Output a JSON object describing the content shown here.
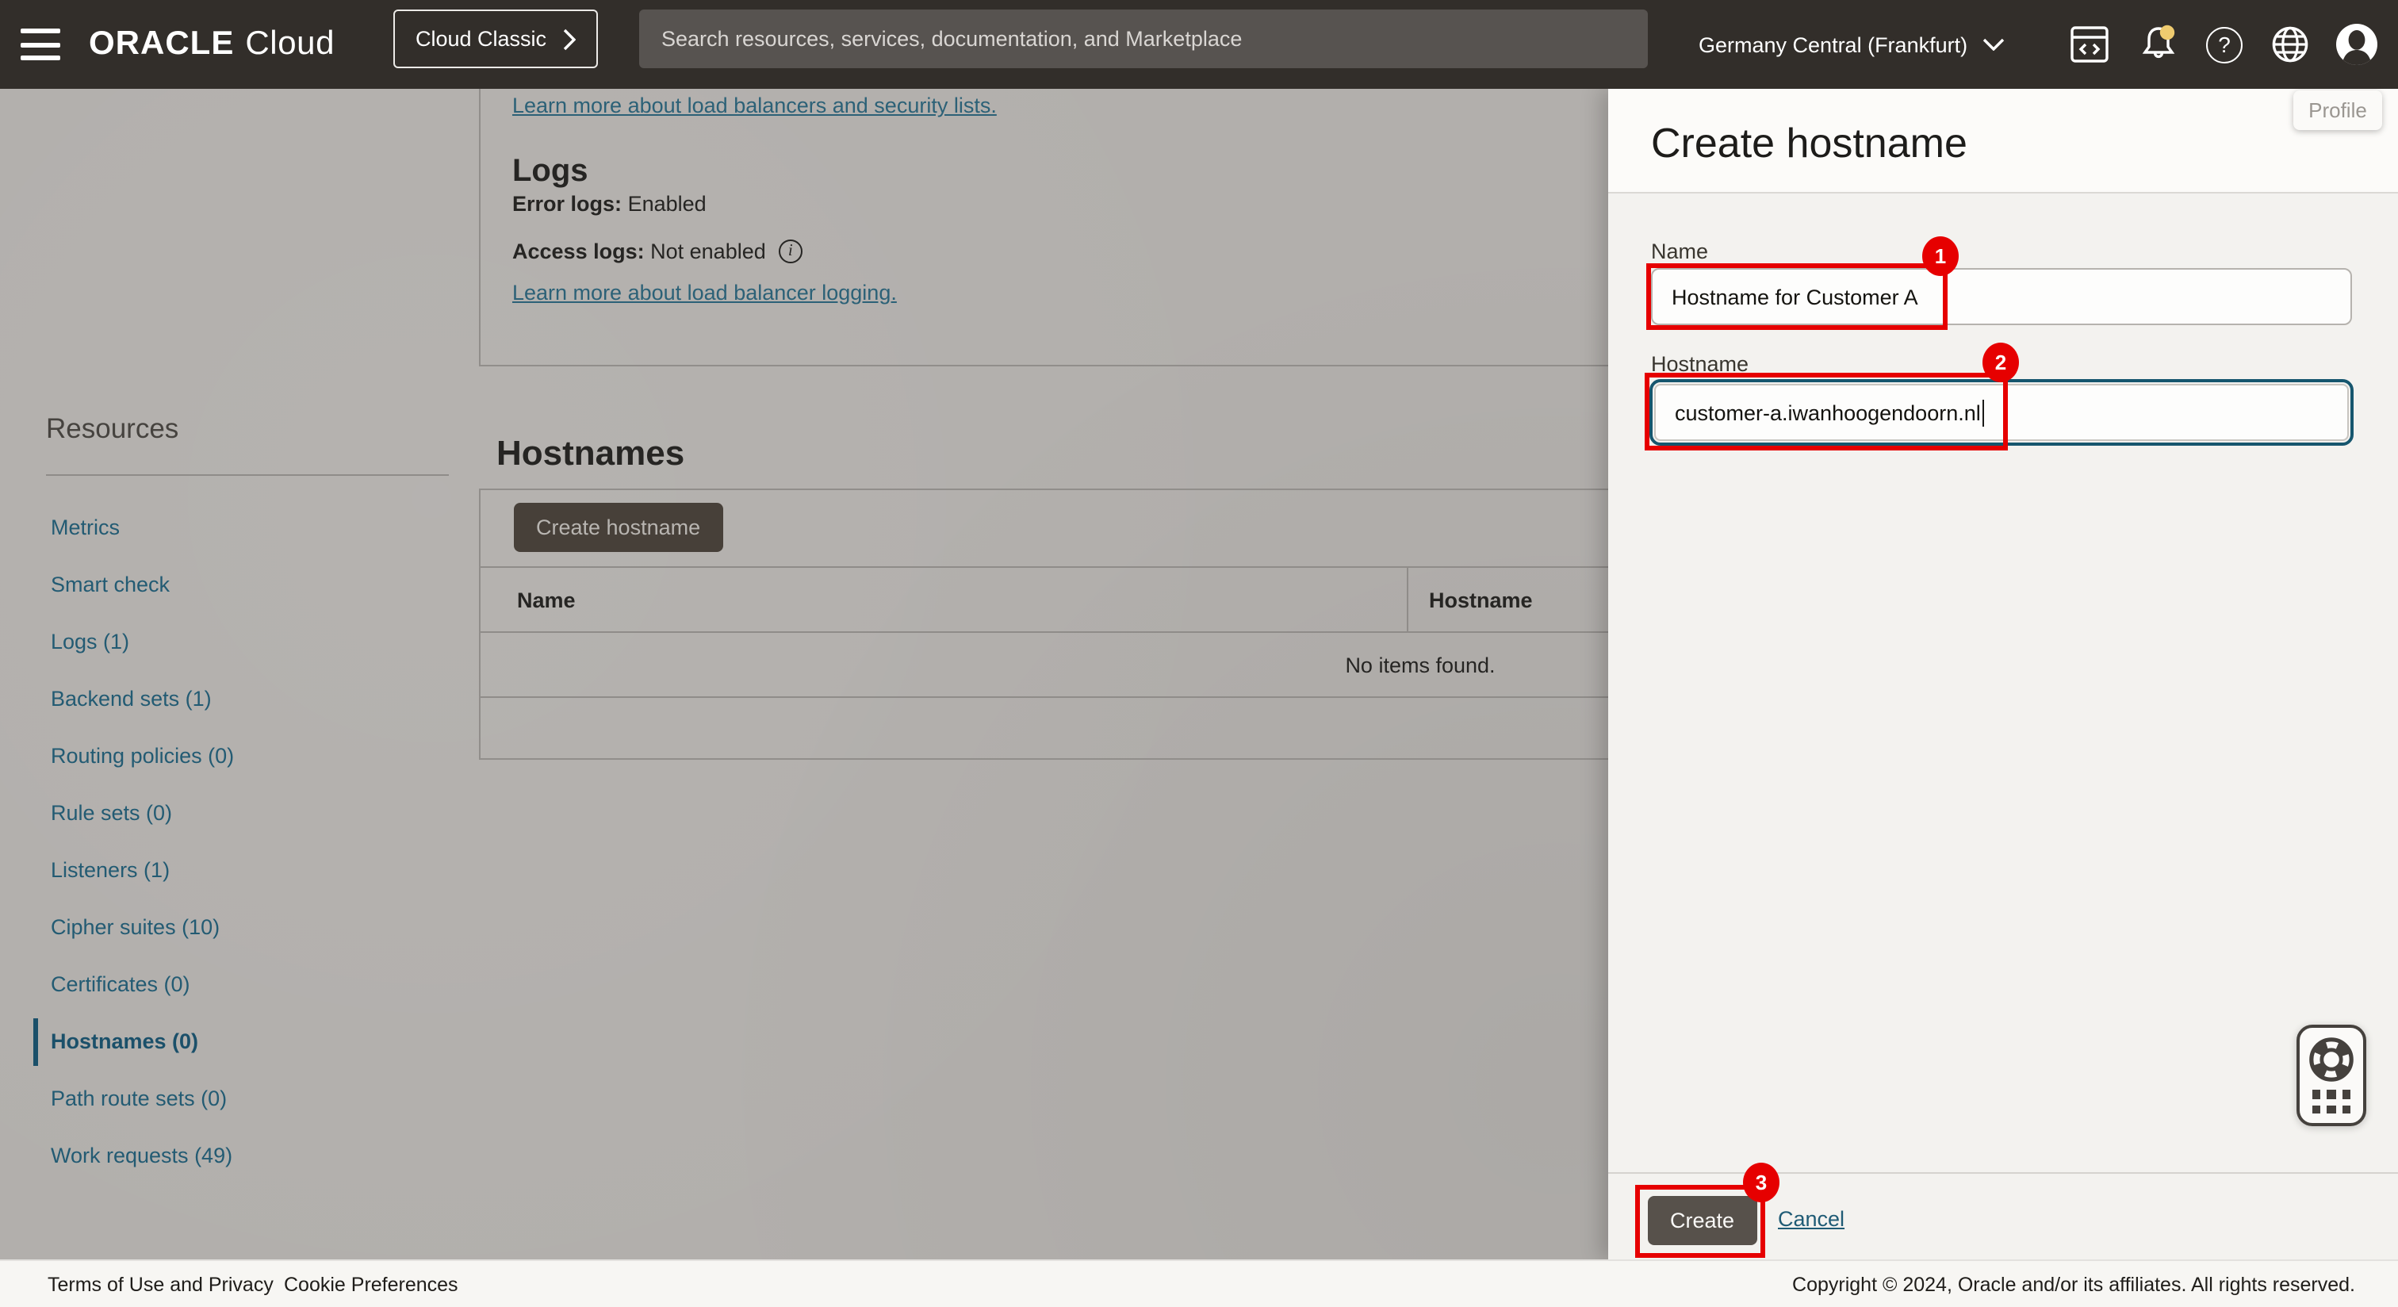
{
  "topbar": {
    "logo_primary": "ORACLE",
    "logo_secondary": "Cloud",
    "cloud_classic_label": "Cloud Classic",
    "search_placeholder": "Search resources, services, documentation, and Marketplace",
    "region_label": "Germany Central (Frankfurt)",
    "help_icon_glyph": "?",
    "profile_tooltip": "Profile"
  },
  "sidebar": {
    "heading": "Resources",
    "items": [
      {
        "label": "Metrics",
        "selected": false
      },
      {
        "label": "Smart check",
        "selected": false
      },
      {
        "label": "Logs (1)",
        "selected": false
      },
      {
        "label": "Backend sets (1)",
        "selected": false
      },
      {
        "label": "Routing policies (0)",
        "selected": false
      },
      {
        "label": "Rule sets (0)",
        "selected": false
      },
      {
        "label": "Listeners (1)",
        "selected": false
      },
      {
        "label": "Cipher suites (10)",
        "selected": false
      },
      {
        "label": "Certificates (0)",
        "selected": false
      },
      {
        "label": "Hostnames (0)",
        "selected": true
      },
      {
        "label": "Path route sets (0)",
        "selected": false
      },
      {
        "label": "Work requests (49)",
        "selected": false
      }
    ]
  },
  "main": {
    "logs_card": {
      "link_security_lists": "Learn more about load balancers and security lists.",
      "heading": "Logs",
      "error_logs_label": "Error logs:",
      "error_logs_value": "Enabled",
      "access_logs_label": "Access logs:",
      "access_logs_value": "Not enabled",
      "info_icon_glyph": "i",
      "link_logging": "Learn more about load balancer logging."
    },
    "hostnames_section": {
      "heading": "Hostnames",
      "create_button_label": "Create hostname",
      "table_headers": [
        "Name",
        "Hostname"
      ],
      "empty_message": "No items found."
    }
  },
  "drawer": {
    "title": "Create hostname",
    "name_label": "Name",
    "name_value": "Hostname for Customer A",
    "hostname_label": "Hostname",
    "hostname_value": "customer-a.iwanhoogendoorn.nl",
    "create_button_label": "Create",
    "cancel_label": "Cancel",
    "annotations": {
      "step1": "1",
      "step2": "2",
      "step3": "3"
    }
  },
  "footer": {
    "terms": "Terms of Use and Privacy",
    "cookies": "Cookie Preferences",
    "copyright": "Copyright © 2024, Oracle and/or its affiliates. All rights reserved."
  },
  "colors": {
    "topbar_bg": "#322e2a",
    "dim_overlay_gray": "#b2afac",
    "link_teal": "#1f5b75",
    "focus_ring_teal": "#16566e",
    "annotation_red": "#e60000",
    "notification_dot": "#efcb6f",
    "drawer_bg": "#f3f2ef",
    "dark_button": "#57514b"
  }
}
